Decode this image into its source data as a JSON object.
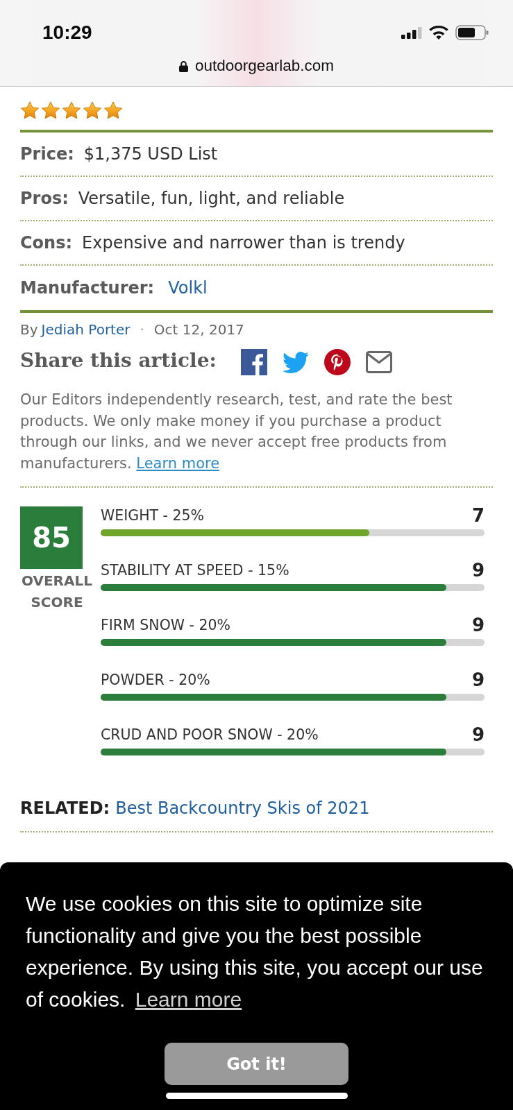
{
  "status_bar": {
    "time": "10:29",
    "url": "outdoorgearlab.com"
  },
  "rating": {
    "stars": 5
  },
  "specs": [
    {
      "kind": "text",
      "label": "Price:",
      "value": "$1,375 USD List"
    },
    {
      "kind": "text",
      "label": "Pros:",
      "value": "Versatile, fun, light, and reliable"
    },
    {
      "kind": "text",
      "label": "Cons:",
      "value": "Expensive and narrower than is trendy"
    },
    {
      "kind": "link",
      "label": "Manufacturer:",
      "value": "Volkl"
    }
  ],
  "byline": {
    "prefix": "By",
    "author": "Jediah Porter",
    "separator": "·",
    "date": "Oct 12, 2017"
  },
  "share": {
    "heading": "Share this article:"
  },
  "disclosure": {
    "text": "Our Editors independently research, test, and rate the best products. We only make money if you purchase a product through our links, and we never accept free products from manufacturers.",
    "link": "Learn more"
  },
  "scores": {
    "overall": "85",
    "overall_label": "OVERALL SCORE",
    "metrics": [
      {
        "label": "WEIGHT - 25%",
        "score": "7",
        "level": 0.7,
        "color": "#6fa52a"
      },
      {
        "label": "STABILITY AT SPEED - 15%",
        "score": "9",
        "level": 0.9,
        "color": "#2b7d3b"
      },
      {
        "label": "FIRM SNOW - 20%",
        "score": "9",
        "level": 0.9,
        "color": "#2b7d3b"
      },
      {
        "label": "POWDER - 20%",
        "score": "9",
        "level": 0.9,
        "color": "#2b7d3b"
      },
      {
        "label": "CRUD AND POOR SNOW - 20%",
        "score": "9",
        "level": 0.9,
        "color": "#2b7d3b"
      }
    ]
  },
  "related": {
    "label": "RELATED:",
    "link": "Best Backcountry Skis of 2021"
  },
  "cookie_banner": {
    "message": "We use cookies on this site to optimize site functionality and give you the best possible experience. By using this site, you accept our use of cookies.",
    "link": "Learn more",
    "button": "Got it!"
  }
}
